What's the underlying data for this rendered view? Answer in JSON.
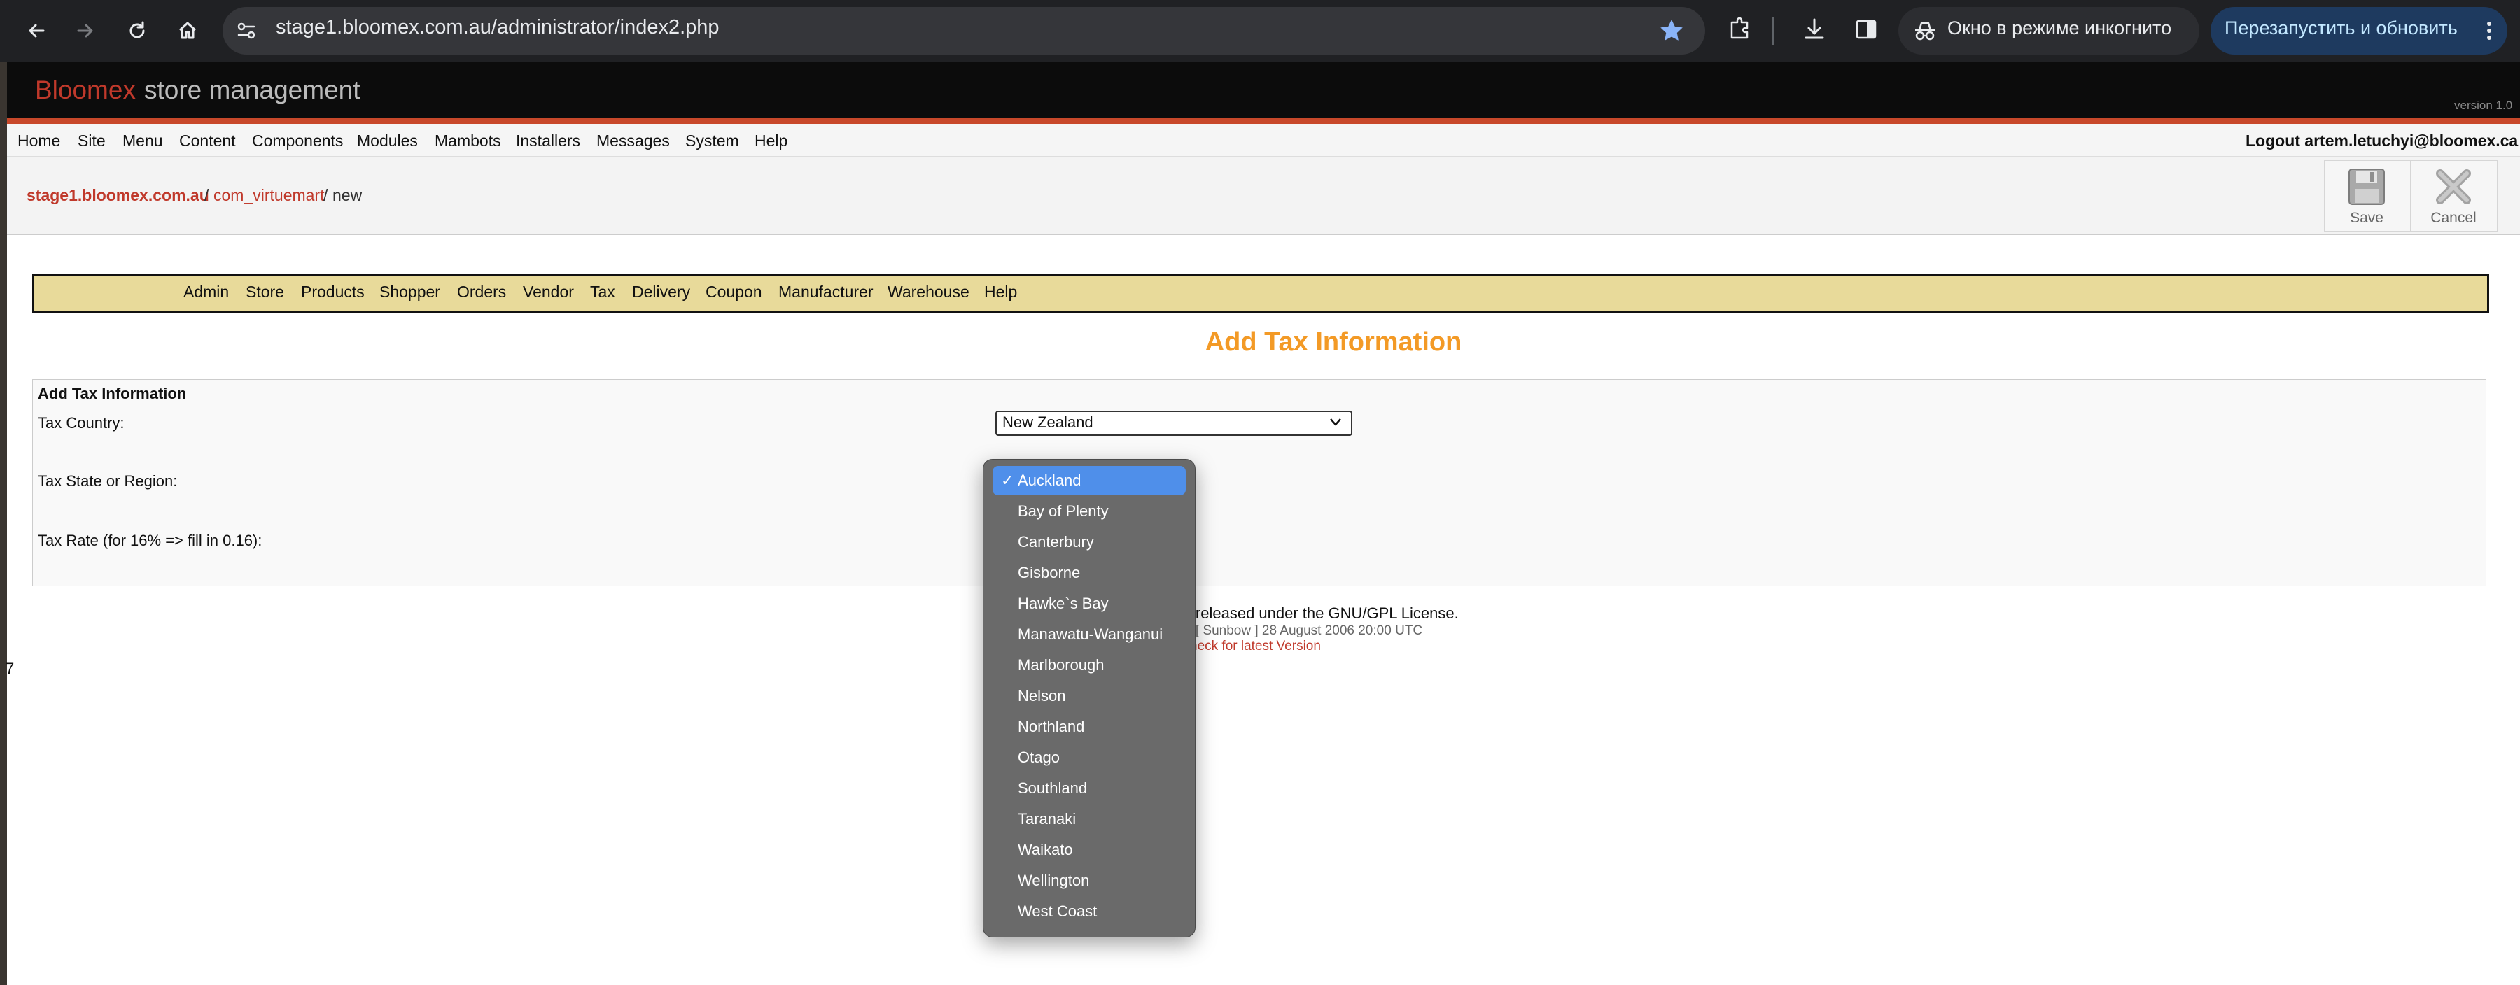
{
  "browser": {
    "url": "stage1.bloomex.com.au/administrator/index2.php",
    "incognito_label": "Окно в режиме инкогнито",
    "relaunch_label": "Перезапустить и обновить"
  },
  "banner": {
    "logo": "Bloomex",
    "subtitle": "store management",
    "version": "version 1.0"
  },
  "top_menu": {
    "items": [
      "Home",
      "Site",
      "Menu",
      "Content",
      "Components",
      "Modules",
      "Mambots",
      "Installers",
      "Messages",
      "System",
      "Help"
    ],
    "logout": "Logout artem.letuchyi@bloomex.ca"
  },
  "pathway": {
    "site": "stage1.bloomex.com.au",
    "sep": "/",
    "component": "com_virtuemart",
    "task": "new"
  },
  "toolbar": {
    "save": "Save",
    "cancel": "Cancel"
  },
  "vm_menu": [
    "Admin",
    "Store",
    "Products",
    "Shopper",
    "Orders",
    "Vendor",
    "Tax",
    "Delivery",
    "Coupon",
    "Manufacturer",
    "Warehouse",
    "Help"
  ],
  "page_heading": "Add Tax Information",
  "form": {
    "legend": "Add Tax Information",
    "country_label": "Tax Country:",
    "country_value": "New Zealand",
    "state_label": "Tax State or Region:",
    "rate_label": "Tax Rate (for 16% => fill in 0.16):"
  },
  "dropdown": {
    "selected": "Auckland",
    "check": "✓",
    "options": [
      "Auckland",
      "Bay of Plenty",
      "Canterbury",
      "Gisborne",
      "Hawke`s Bay",
      "Manawatu-Wanganui",
      "Marlborough",
      "Nelson",
      "Northland",
      "Otago",
      "Southland",
      "Taranaki",
      "Waikato",
      "Wellington",
      "West Coast"
    ]
  },
  "footer": {
    "line1": "are released under the GNU/GPL License.",
    "line2": "e [ Sunbow ] 28 August 2006 20:00 UTC",
    "line3": "heck for latest Version"
  },
  "stray": "7",
  "colors": {
    "accent_red": "#c0392b",
    "heading_orange": "#f39a26",
    "menu_yellow": "#e8da9a",
    "selection_blue": "#4f8fea"
  }
}
